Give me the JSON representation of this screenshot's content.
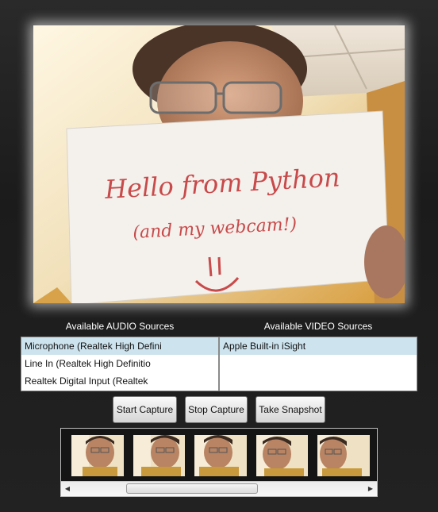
{
  "preview": {
    "sign_line1": "Hello from Python",
    "sign_line2": "(and my webcam!)"
  },
  "audio": {
    "label": "Available AUDIO Sources",
    "items": [
      "Microphone (Realtek High Defini",
      "Line In (Realtek High Definitio",
      "Realtek Digital Input (Realtek"
    ],
    "selected_index": 0
  },
  "video": {
    "label": "Available VIDEO Sources",
    "items": [
      "Apple Built-in iSight"
    ],
    "selected_index": 0
  },
  "buttons": {
    "start": "Start Capture",
    "stop": "Stop Capture",
    "snapshot": "Take Snapshot"
  },
  "snapshots": {
    "count_visible": 5
  },
  "scroll": {
    "left_icon": "left-arrow-icon",
    "right_icon": "right-arrow-icon"
  }
}
